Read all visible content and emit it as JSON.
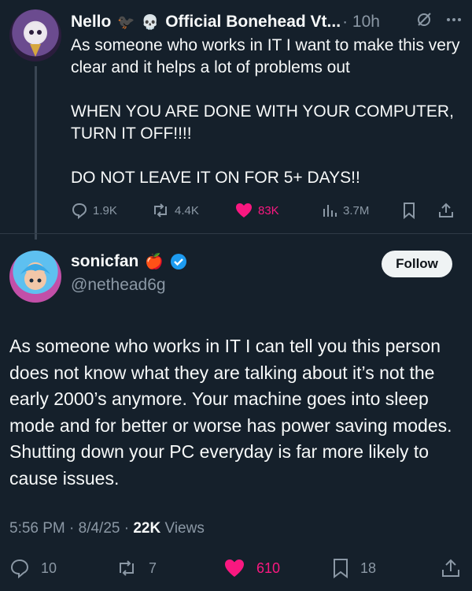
{
  "parent": {
    "name": "Nello",
    "emoji1": "🐦‍⬛",
    "emoji2": "💀",
    "display2": "Official Bonehead Vt...",
    "time": "· 10h",
    "text": "As someone who works in IT I want to make this very clear and it helps a lot of problems out\n\nWHEN YOU ARE DONE WITH YOUR COMPUTER, TURN IT OFF!!!!\n\nDO NOT LEAVE IT ON FOR 5+ DAYS!!",
    "replies": "1.9K",
    "reposts": "4.4K",
    "likes": "83K",
    "views": "3.7M"
  },
  "tweet": {
    "name": "sonicfan",
    "emoji": "🍎",
    "handle": "@nethead6g",
    "follow_label": "Follow",
    "text": "As someone who works in IT I can tell you this person does not know what they are talking about it’s not the early 2000’s anymore. Your machine goes into sleep mode and for better or worse has power saving modes. Shutting down your PC everyday is far more likely to cause issues.",
    "time": "5:56 PM · 8/4/25 · ",
    "views_count": "22K",
    "views_label": " Views",
    "replies": "10",
    "reposts": "7",
    "likes": "610",
    "bookmarks": "18"
  },
  "colors": {
    "background": "#15202b",
    "like": "#f91880",
    "verified": "#1d9bf0",
    "muted": "#8b98a5"
  }
}
